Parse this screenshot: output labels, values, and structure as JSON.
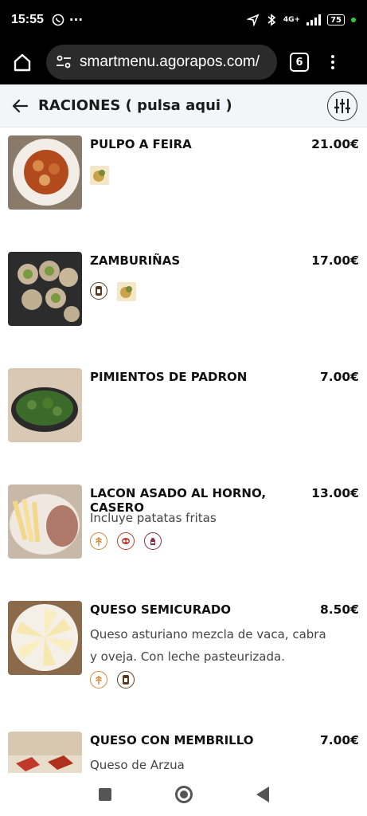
{
  "status": {
    "time": "15:55",
    "whatsapp_icon": "whatsapp-icon",
    "more": "···",
    "network": "4G+",
    "battery": "75"
  },
  "browser": {
    "url": "smartmenu.agorapos.com/",
    "tab_count": "6"
  },
  "header": {
    "title": "RACIONES ( pulsa aqui )"
  },
  "items": [
    {
      "name": "PULPO A FEIRA",
      "price": "21.00€",
      "description": "",
      "allergens": [
        "mollusc-photo"
      ]
    },
    {
      "name": "ZAMBURIÑAS",
      "price": "17.00€",
      "description": "",
      "allergens": [
        "sulphites-icon",
        "mollusc-photo"
      ]
    },
    {
      "name": "PIMIENTOS DE PADRON",
      "price": "7.00€",
      "description": "",
      "allergens": []
    },
    {
      "name": "LACON ASADO AL HORNO, CASERO",
      "price": "13.00€",
      "description": "Incluye patatas fritas",
      "allergens": [
        "gluten-icon",
        "soy-icon",
        "milk-icon"
      ]
    },
    {
      "name": "QUESO SEMICURADO",
      "price": "8.50€",
      "description": "Queso asturiano mezcla de vaca, cabra y oveja. Con leche pasteurizada.",
      "allergens": [
        "gluten-icon",
        "sulphites-icon"
      ]
    },
    {
      "name": "QUESO CON MEMBRILLO",
      "price": "7.00€",
      "description": "Queso de Arzua",
      "allergens": []
    }
  ],
  "colors": {
    "header_bg": "#f3f5f8",
    "gluten": "#d9873a",
    "soy": "#c0392b",
    "milk": "#8e2a4a",
    "sulphites": "#5a3a1e"
  }
}
